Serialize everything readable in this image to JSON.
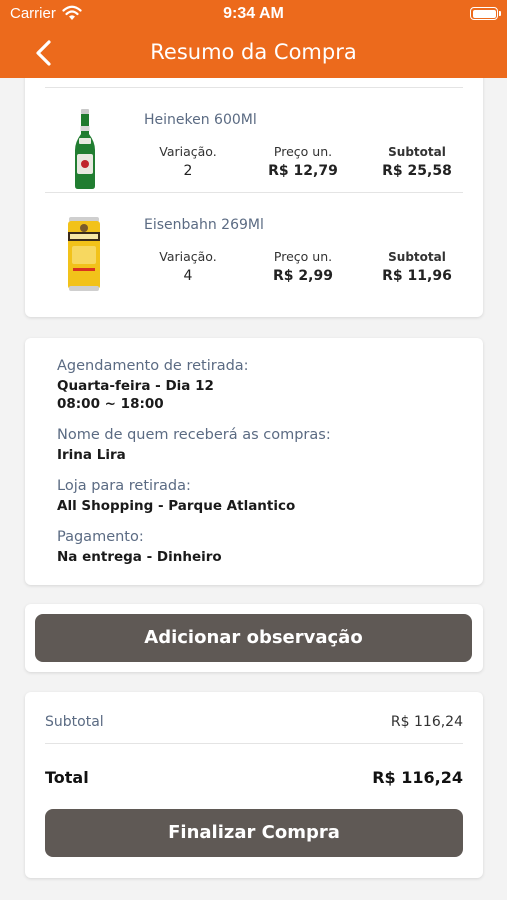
{
  "status_bar": {
    "carrier": "Carrier",
    "time": "9:34 AM"
  },
  "header": {
    "title": "Resumo da Compra",
    "back_icon": "chevron-left-icon"
  },
  "colors": {
    "brand": "#ec6a1c",
    "button": "#5f5955",
    "label": "#5b6b83"
  },
  "products": [
    {
      "name": "Heineken 600Ml",
      "image": "green-beer-bottle",
      "variation_label": "Variação.",
      "variation": "2",
      "price_label": "Preço un.",
      "price": "R$ 12,79",
      "subtotal_label": "Subtotal",
      "subtotal": "R$ 25,58"
    },
    {
      "name": "Eisenbahn 269Ml",
      "image": "yellow-beer-can",
      "variation_label": "Variação.",
      "variation": "4",
      "price_label": "Preço un.",
      "price": "R$ 2,99",
      "subtotal_label": "Subtotal",
      "subtotal": "R$ 11,96"
    }
  ],
  "info": {
    "schedule_label": "Agendamento de retirada:",
    "schedule_day": "Quarta-feira - Dia 12",
    "schedule_time": "08:00 ~ 18:00",
    "receiver_label": "Nome de quem receberá as compras:",
    "receiver": "Irina Lira",
    "store_label": "Loja para retirada:",
    "store": "All Shopping - Parque Atlantico",
    "payment_label": "Pagamento:",
    "payment": "Na entrega - Dinheiro"
  },
  "observation_button": "Adicionar observação",
  "summary": {
    "subtotal_label": "Subtotal",
    "subtotal": "R$ 116,24",
    "total_label": "Total",
    "total": "R$ 116,24",
    "finish_button": "Finalizar Compra"
  }
}
